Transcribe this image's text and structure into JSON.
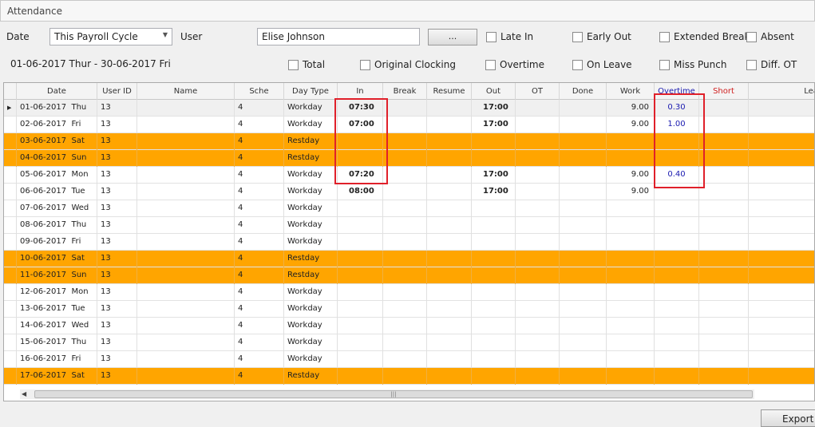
{
  "window": {
    "title": "Attendance"
  },
  "filters": {
    "date_label": "Date",
    "date_value": "This Payroll Cycle",
    "user_label": "User",
    "user_value": "Elise Johnson",
    "browse_label": "...",
    "range_text": "01-06-2017 Thur - 30-06-2017 Fri"
  },
  "checkboxes": [
    {
      "label": "Late In",
      "checked": false
    },
    {
      "label": "Early Out",
      "checked": false
    },
    {
      "label": "Extended Break",
      "checked": false
    },
    {
      "label": "Absent",
      "checked": false
    },
    {
      "label": "Total",
      "checked": false
    },
    {
      "label": "Original Clocking",
      "checked": false
    },
    {
      "label": "Overtime",
      "checked": false
    },
    {
      "label": "On Leave",
      "checked": false
    },
    {
      "label": "Miss Punch",
      "checked": false
    },
    {
      "label": "Diff. OT",
      "checked": false
    }
  ],
  "columns": [
    "Date",
    "User ID",
    "Name",
    "Sche",
    "Day Type",
    "In",
    "Break",
    "Resume",
    "Out",
    "OT",
    "Done",
    "Work",
    "Overtime",
    "Short",
    "Leave Typ"
  ],
  "column_colors": {
    "Overtime": "#1a1ab0",
    "Short": "#d02020"
  },
  "rows": [
    {
      "date": "01-06-2017",
      "day": "Thu",
      "user_id": "13",
      "name": "",
      "sche": "4",
      "day_type": "Workday",
      "in": "07:30",
      "break": "",
      "resume": "",
      "out": "17:00",
      "ot": "",
      "done": "",
      "work": "9.00",
      "overtime": "0.30",
      "short": "",
      "leave": "",
      "restday": false
    },
    {
      "date": "02-06-2017",
      "day": "Fri",
      "user_id": "13",
      "name": "",
      "sche": "4",
      "day_type": "Workday",
      "in": "07:00",
      "break": "",
      "resume": "",
      "out": "17:00",
      "ot": "",
      "done": "",
      "work": "9.00",
      "overtime": "1.00",
      "short": "",
      "leave": "",
      "restday": false
    },
    {
      "date": "03-06-2017",
      "day": "Sat",
      "user_id": "13",
      "name": "",
      "sche": "4",
      "day_type": "Restday",
      "in": "",
      "break": "",
      "resume": "",
      "out": "",
      "ot": "",
      "done": "",
      "work": "",
      "overtime": "",
      "short": "",
      "leave": "",
      "restday": true
    },
    {
      "date": "04-06-2017",
      "day": "Sun",
      "user_id": "13",
      "name": "",
      "sche": "4",
      "day_type": "Restday",
      "in": "",
      "break": "",
      "resume": "",
      "out": "",
      "ot": "",
      "done": "",
      "work": "",
      "overtime": "",
      "short": "",
      "leave": "",
      "restday": true
    },
    {
      "date": "05-06-2017",
      "day": "Mon",
      "user_id": "13",
      "name": "",
      "sche": "4",
      "day_type": "Workday",
      "in": "07:20",
      "break": "",
      "resume": "",
      "out": "17:00",
      "ot": "",
      "done": "",
      "work": "9.00",
      "overtime": "0.40",
      "short": "",
      "leave": "",
      "restday": false
    },
    {
      "date": "06-06-2017",
      "day": "Tue",
      "user_id": "13",
      "name": "",
      "sche": "4",
      "day_type": "Workday",
      "in": "08:00",
      "break": "",
      "resume": "",
      "out": "17:00",
      "ot": "",
      "done": "",
      "work": "9.00",
      "overtime": "",
      "short": "",
      "leave": "",
      "restday": false
    },
    {
      "date": "07-06-2017",
      "day": "Wed",
      "user_id": "13",
      "name": "",
      "sche": "4",
      "day_type": "Workday",
      "in": "",
      "break": "",
      "resume": "",
      "out": "",
      "ot": "",
      "done": "",
      "work": "",
      "overtime": "",
      "short": "",
      "leave": "",
      "restday": false
    },
    {
      "date": "08-06-2017",
      "day": "Thu",
      "user_id": "13",
      "name": "",
      "sche": "4",
      "day_type": "Workday",
      "in": "",
      "break": "",
      "resume": "",
      "out": "",
      "ot": "",
      "done": "",
      "work": "",
      "overtime": "",
      "short": "",
      "leave": "",
      "restday": false
    },
    {
      "date": "09-06-2017",
      "day": "Fri",
      "user_id": "13",
      "name": "",
      "sche": "4",
      "day_type": "Workday",
      "in": "",
      "break": "",
      "resume": "",
      "out": "",
      "ot": "",
      "done": "",
      "work": "",
      "overtime": "",
      "short": "",
      "leave": "",
      "restday": false
    },
    {
      "date": "10-06-2017",
      "day": "Sat",
      "user_id": "13",
      "name": "",
      "sche": "4",
      "day_type": "Restday",
      "in": "",
      "break": "",
      "resume": "",
      "out": "",
      "ot": "",
      "done": "",
      "work": "",
      "overtime": "",
      "short": "",
      "leave": "",
      "restday": true
    },
    {
      "date": "11-06-2017",
      "day": "Sun",
      "user_id": "13",
      "name": "",
      "sche": "4",
      "day_type": "Restday",
      "in": "",
      "break": "",
      "resume": "",
      "out": "",
      "ot": "",
      "done": "",
      "work": "",
      "overtime": "",
      "short": "",
      "leave": "",
      "restday": true
    },
    {
      "date": "12-06-2017",
      "day": "Mon",
      "user_id": "13",
      "name": "",
      "sche": "4",
      "day_type": "Workday",
      "in": "",
      "break": "",
      "resume": "",
      "out": "",
      "ot": "",
      "done": "",
      "work": "",
      "overtime": "",
      "short": "",
      "leave": "",
      "restday": false
    },
    {
      "date": "13-06-2017",
      "day": "Tue",
      "user_id": "13",
      "name": "",
      "sche": "4",
      "day_type": "Workday",
      "in": "",
      "break": "",
      "resume": "",
      "out": "",
      "ot": "",
      "done": "",
      "work": "",
      "overtime": "",
      "short": "",
      "leave": "",
      "restday": false
    },
    {
      "date": "14-06-2017",
      "day": "Wed",
      "user_id": "13",
      "name": "",
      "sche": "4",
      "day_type": "Workday",
      "in": "",
      "break": "",
      "resume": "",
      "out": "",
      "ot": "",
      "done": "",
      "work": "",
      "overtime": "",
      "short": "",
      "leave": "",
      "restday": false
    },
    {
      "date": "15-06-2017",
      "day": "Thu",
      "user_id": "13",
      "name": "",
      "sche": "4",
      "day_type": "Workday",
      "in": "",
      "break": "",
      "resume": "",
      "out": "",
      "ot": "",
      "done": "",
      "work": "",
      "overtime": "",
      "short": "",
      "leave": "",
      "restday": false
    },
    {
      "date": "16-06-2017",
      "day": "Fri",
      "user_id": "13",
      "name": "",
      "sche": "4",
      "day_type": "Workday",
      "in": "",
      "break": "",
      "resume": "",
      "out": "",
      "ot": "",
      "done": "",
      "work": "",
      "overtime": "",
      "short": "",
      "leave": "",
      "restday": false
    },
    {
      "date": "17-06-2017",
      "day": "Sat",
      "user_id": "13",
      "name": "",
      "sche": "4",
      "day_type": "Restday",
      "in": "",
      "break": "",
      "resume": "",
      "out": "",
      "ot": "",
      "done": "",
      "work": "",
      "overtime": "",
      "short": "",
      "leave": "",
      "restday": true
    }
  ],
  "footer": {
    "export_label": "Export"
  },
  "colors": {
    "restday_row": "#ffa500",
    "highlight": "#e0202a",
    "overtime_text": "#1a1ab0"
  }
}
